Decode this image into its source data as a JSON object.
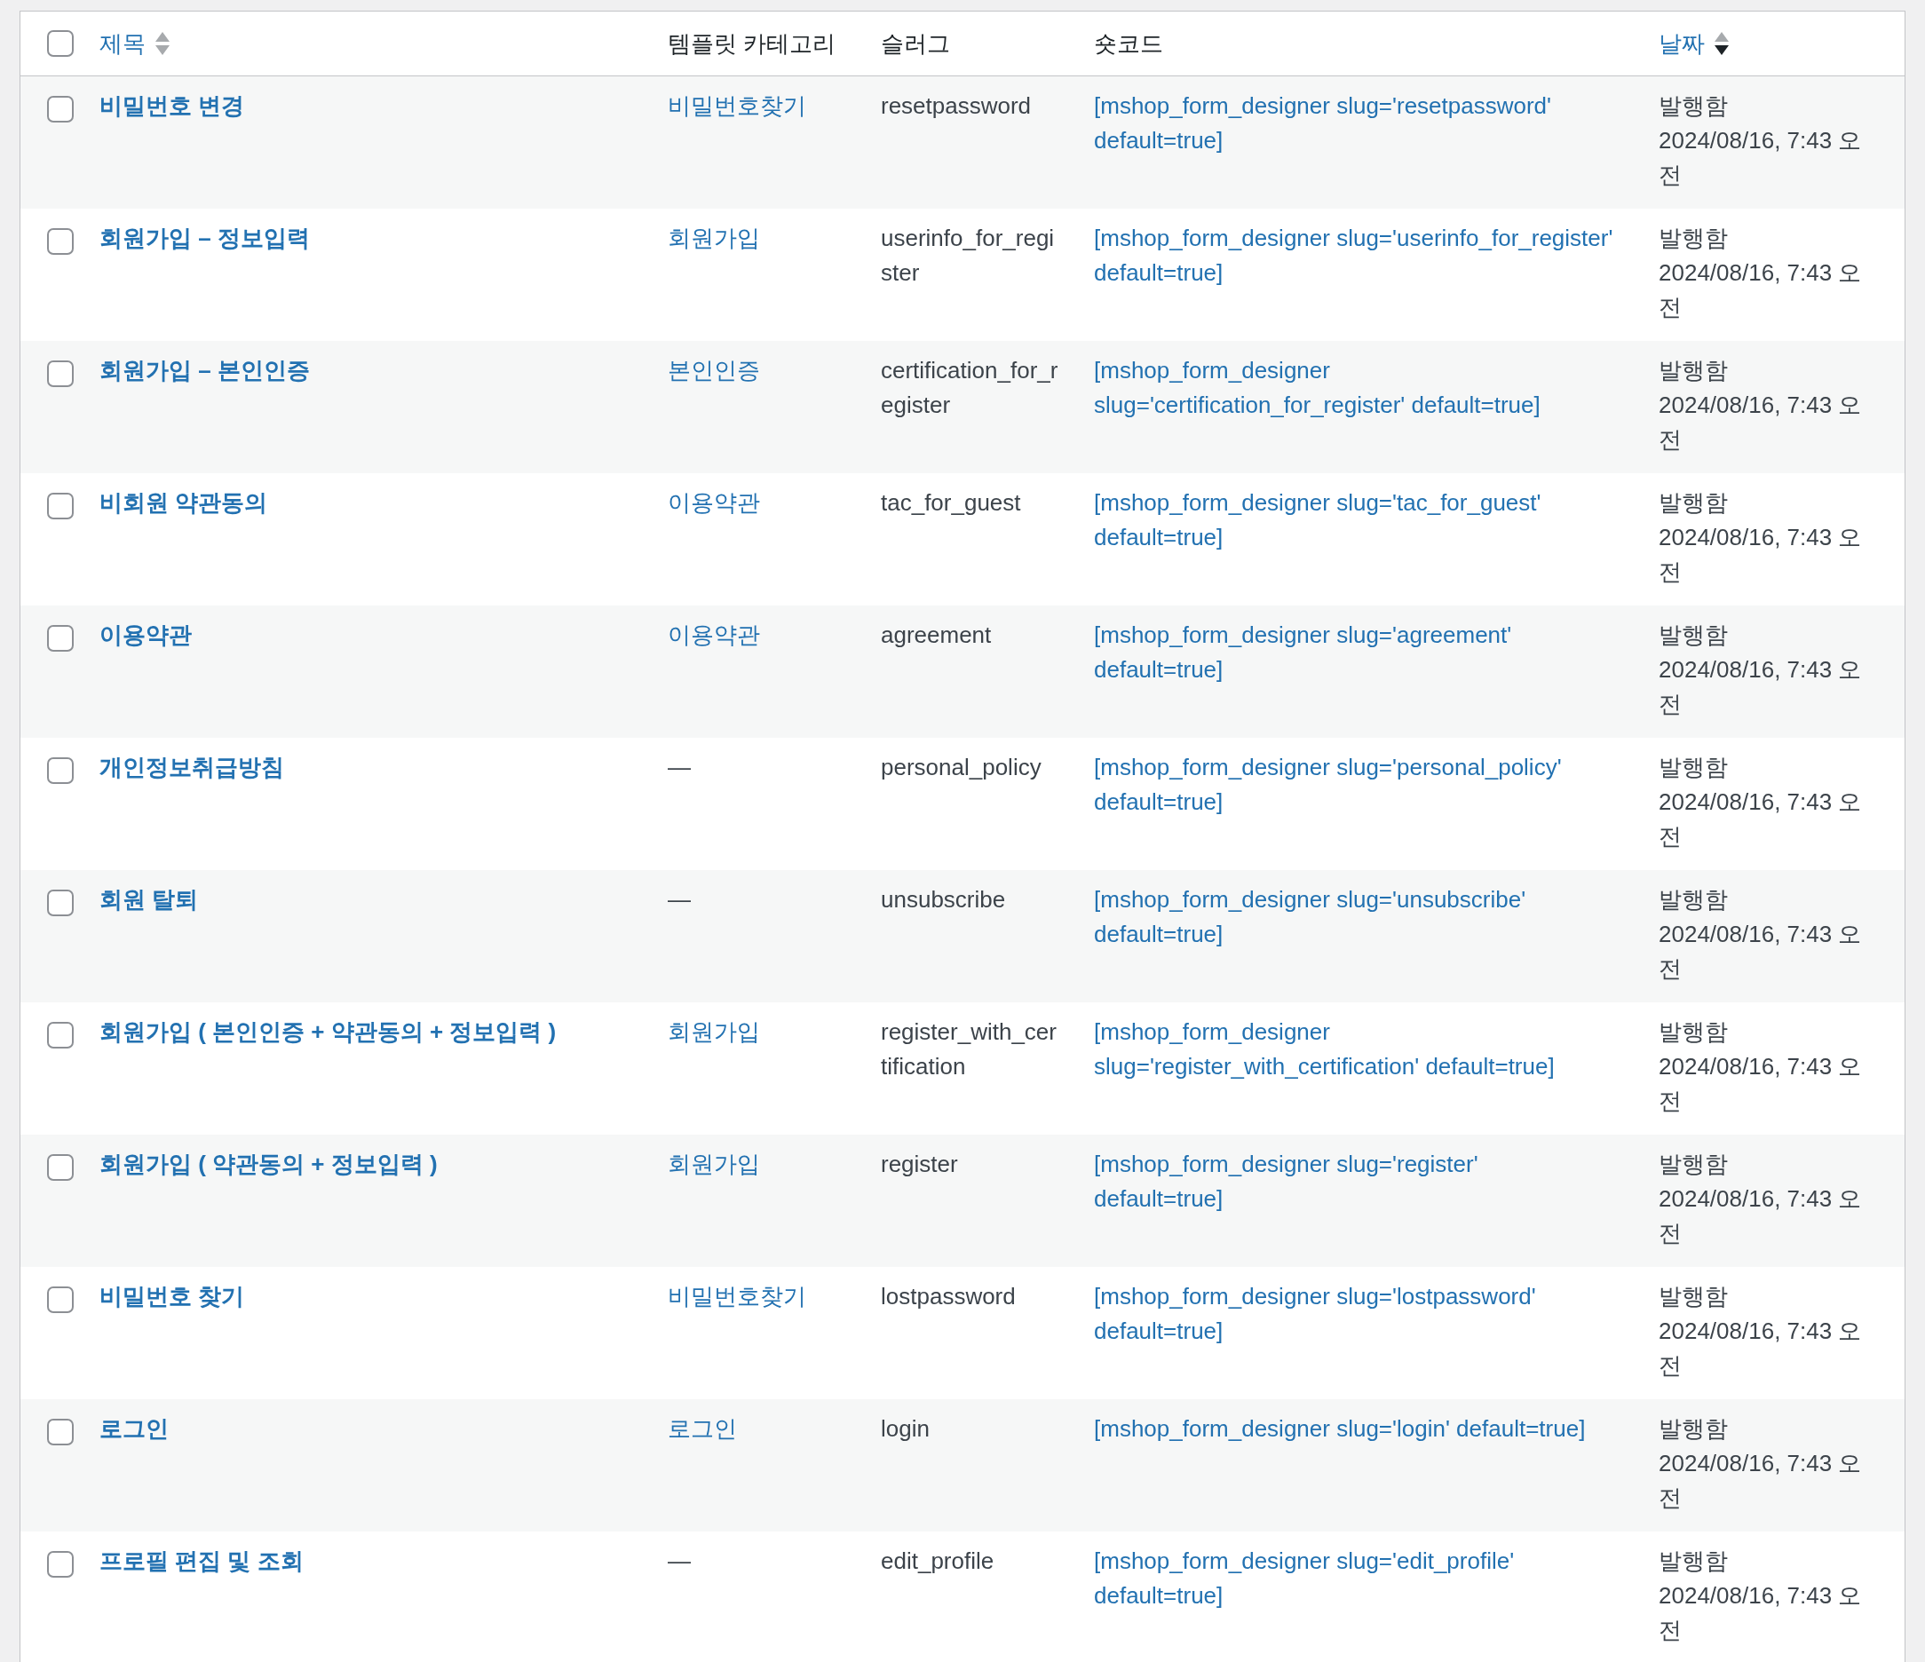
{
  "table": {
    "select_all": {
      "checked": false
    },
    "columns": [
      {
        "label": "제목",
        "kind": "sortable",
        "sorted": false
      },
      {
        "label": "템플릿 카테고리",
        "kind": "plain"
      },
      {
        "label": "슬러그",
        "kind": "plain"
      },
      {
        "label": "숏코드",
        "kind": "plain"
      },
      {
        "label": "날짜",
        "kind": "sortable",
        "sorted": true
      }
    ],
    "rows": [
      {
        "checked": false,
        "title": "비밀번호 변경",
        "category": {
          "text": "비밀번호찾기",
          "link": true
        },
        "slug": "resetpassword",
        "shortcode": "[mshop_form_designer slug='resetpassword' default=true]",
        "status": "발행함",
        "date": "2024/08/16, 7:43 오전"
      },
      {
        "checked": false,
        "title": "회원가입 – 정보입력",
        "category": {
          "text": "회원가입",
          "link": true
        },
        "slug": "userinfo_for_register",
        "shortcode": "[mshop_form_designer slug='userinfo_for_register' default=true]",
        "status": "발행함",
        "date": "2024/08/16, 7:43 오전"
      },
      {
        "checked": false,
        "title": "회원가입 – 본인인증",
        "category": {
          "text": "본인인증",
          "link": true
        },
        "slug": "certification_for_register",
        "shortcode": "[mshop_form_designer slug='certification_for_register' default=true]",
        "status": "발행함",
        "date": "2024/08/16, 7:43 오전"
      },
      {
        "checked": false,
        "title": "비회원 약관동의",
        "category": {
          "text": "이용약관",
          "link": true
        },
        "slug": "tac_for_guest",
        "shortcode": "[mshop_form_designer slug='tac_for_guest' default=true]",
        "status": "발행함",
        "date": "2024/08/16, 7:43 오전"
      },
      {
        "checked": false,
        "title": "이용약관",
        "category": {
          "text": "이용약관",
          "link": true
        },
        "slug": "agreement",
        "shortcode": "[mshop_form_designer slug='agreement' default=true]",
        "status": "발행함",
        "date": "2024/08/16, 7:43 오전"
      },
      {
        "checked": false,
        "title": "개인정보취급방침",
        "category": {
          "text": "—",
          "link": false
        },
        "slug": "personal_policy",
        "shortcode": "[mshop_form_designer slug='personal_policy' default=true]",
        "status": "발행함",
        "date": "2024/08/16, 7:43 오전"
      },
      {
        "checked": false,
        "title": "회원 탈퇴",
        "category": {
          "text": "—",
          "link": false
        },
        "slug": "unsubscribe",
        "shortcode": "[mshop_form_designer slug='unsubscribe' default=true]",
        "status": "발행함",
        "date": "2024/08/16, 7:43 오전"
      },
      {
        "checked": false,
        "title": "회원가입 ( 본인인증 + 약관동의 + 정보입력 )",
        "category": {
          "text": "회원가입",
          "link": true
        },
        "slug": "register_with_certification",
        "shortcode": "[mshop_form_designer slug='register_with_certification' default=true]",
        "status": "발행함",
        "date": "2024/08/16, 7:43 오전"
      },
      {
        "checked": false,
        "title": "회원가입 ( 약관동의 + 정보입력 )",
        "category": {
          "text": "회원가입",
          "link": true
        },
        "slug": "register",
        "shortcode": "[mshop_form_designer slug='register' default=true]",
        "status": "발행함",
        "date": "2024/08/16, 7:43 오전"
      },
      {
        "checked": false,
        "title": "비밀번호 찾기",
        "category": {
          "text": "비밀번호찾기",
          "link": true
        },
        "slug": "lostpassword",
        "shortcode": "[mshop_form_designer slug='lostpassword' default=true]",
        "status": "발행함",
        "date": "2024/08/16, 7:43 오전"
      },
      {
        "checked": false,
        "title": "로그인",
        "category": {
          "text": "로그인",
          "link": true
        },
        "slug": "login",
        "shortcode": "[mshop_form_designer slug='login' default=true]",
        "status": "발행함",
        "date": "2024/08/16, 7:43 오전"
      },
      {
        "checked": false,
        "title": "프로필 편집 및 조회",
        "category": {
          "text": "—",
          "link": false
        },
        "slug": "edit_profile",
        "shortcode": "[mshop_form_designer slug='edit_profile' default=true]",
        "status": "발행함",
        "date": "2024/08/16, 7:43 오전"
      }
    ]
  }
}
